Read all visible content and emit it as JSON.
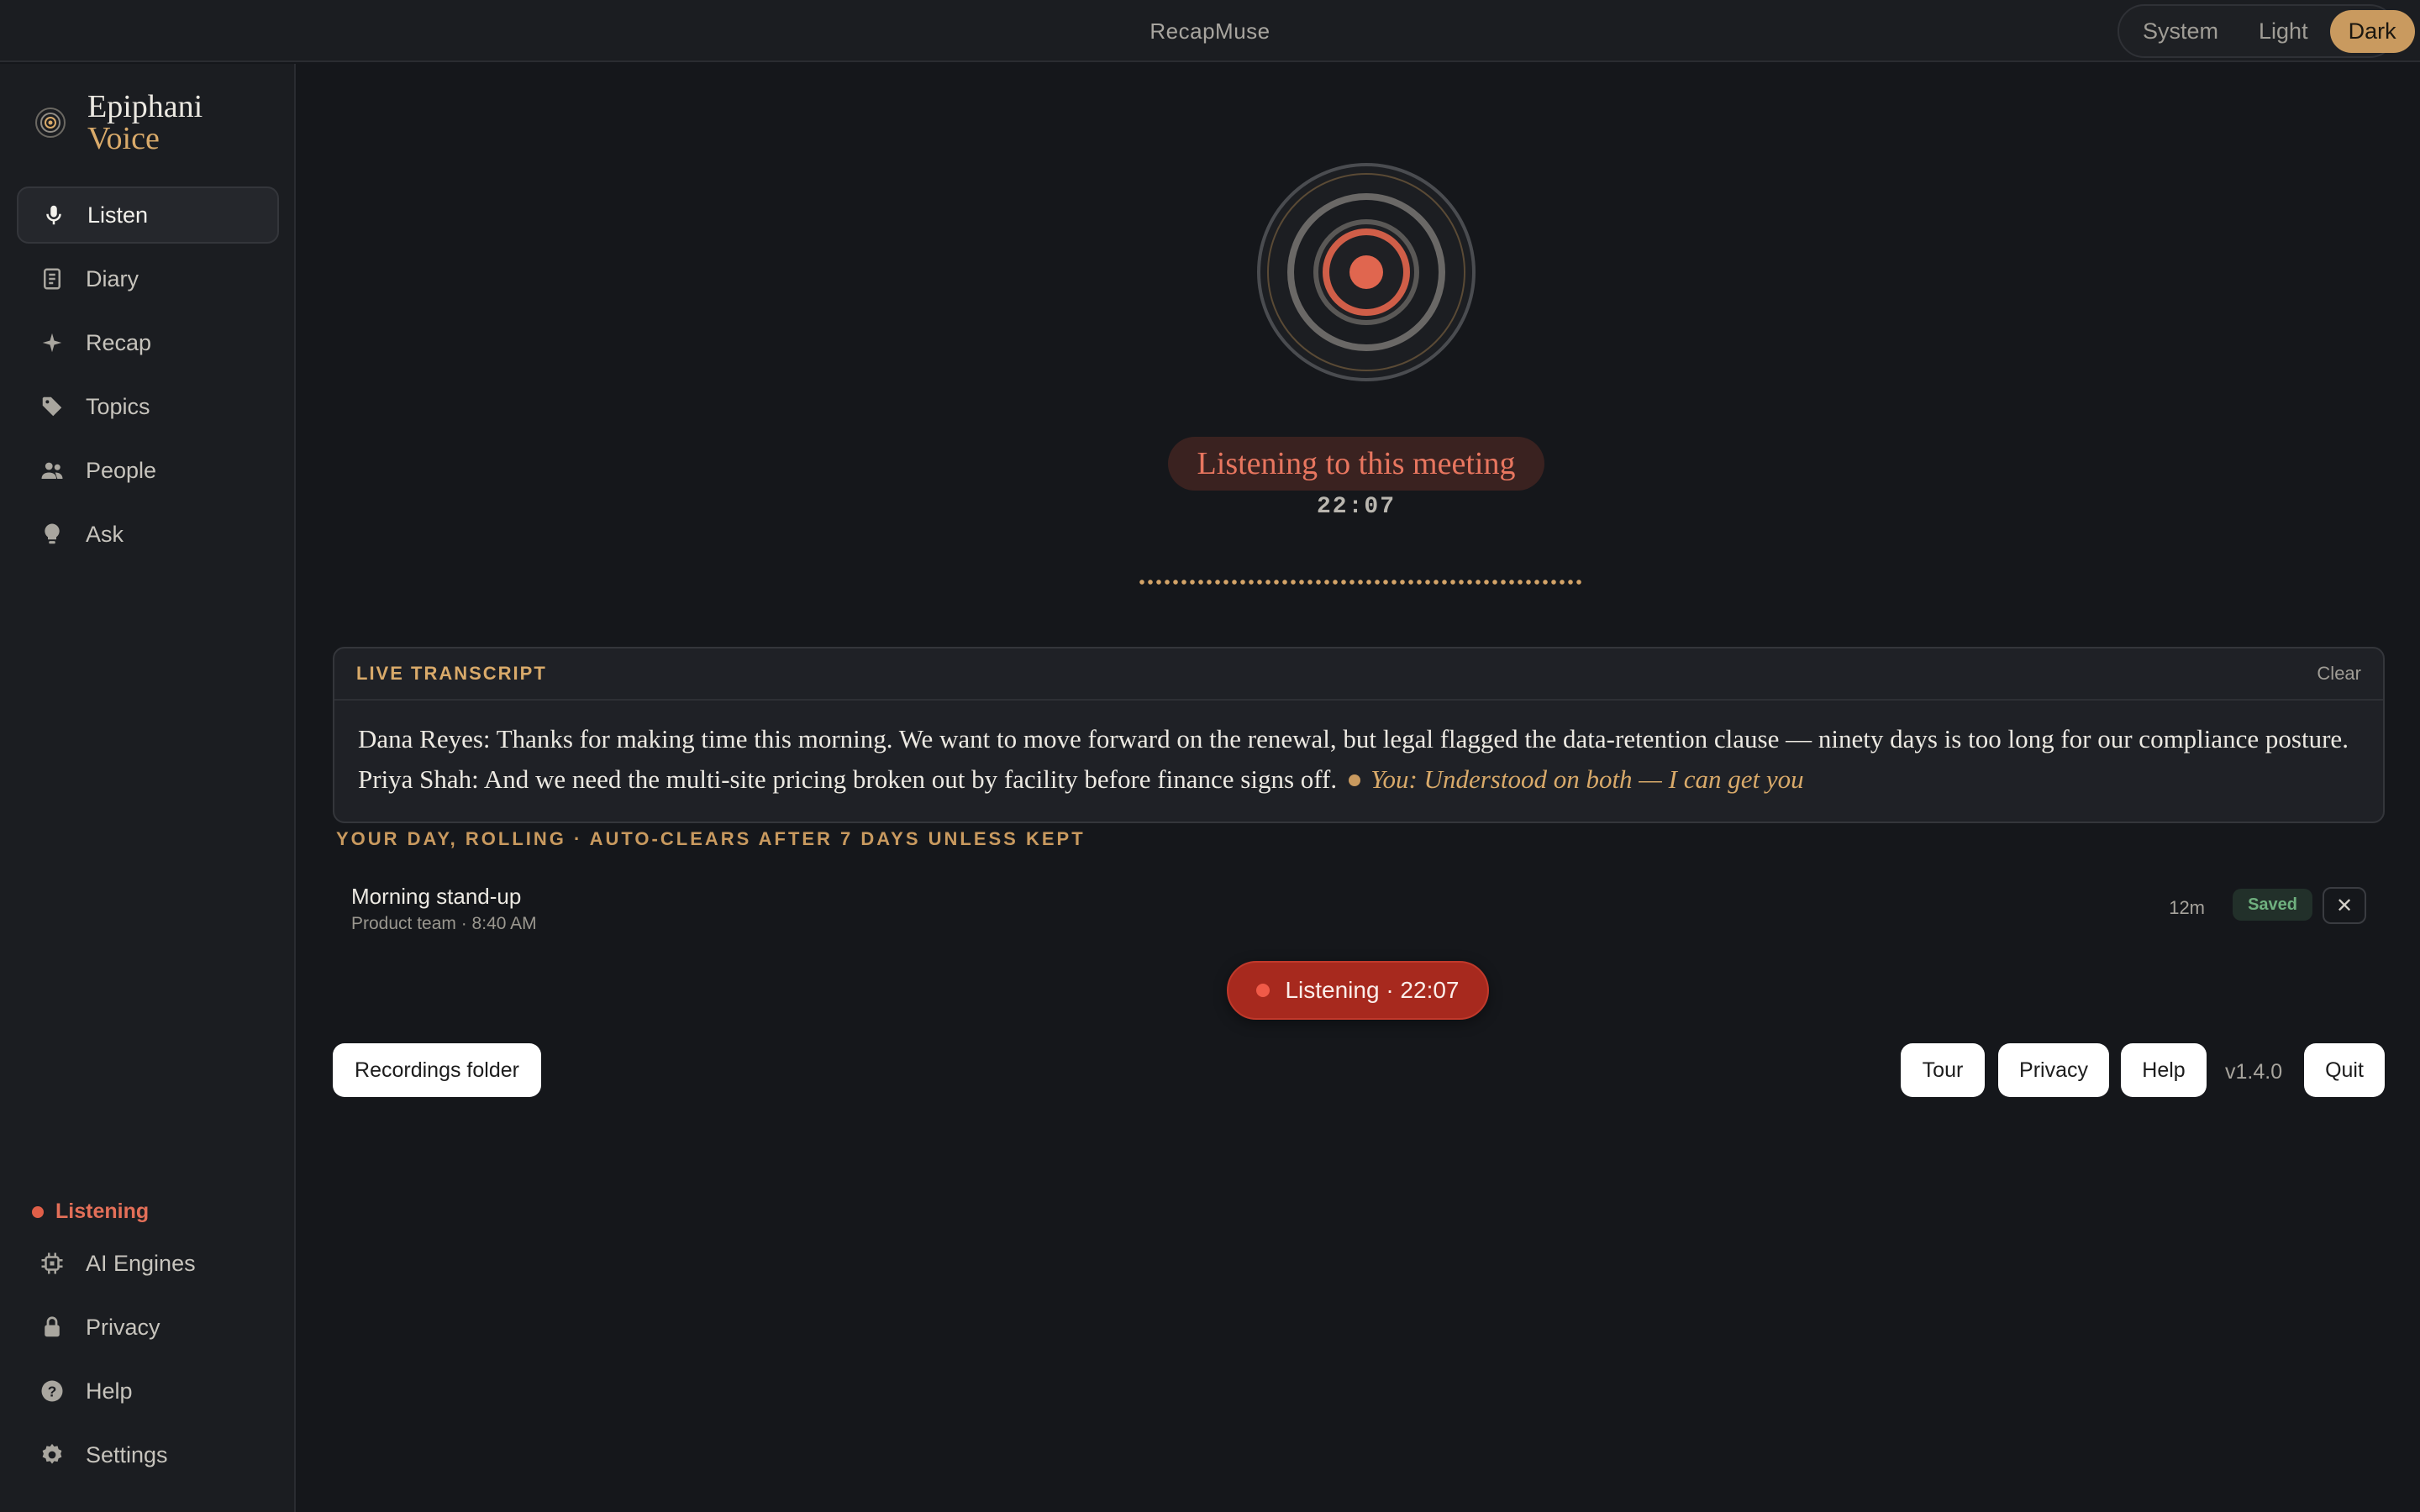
{
  "app": {
    "title": "RecapMuse"
  },
  "theme": {
    "options": [
      "System",
      "Light",
      "Dark"
    ],
    "selected": "Dark"
  },
  "brand": {
    "line1": "Epiphani",
    "line2": "Voice"
  },
  "sidebar": {
    "items": [
      {
        "label": "Listen",
        "icon": "microphone-icon",
        "active": true
      },
      {
        "label": "Diary",
        "icon": "journal-icon"
      },
      {
        "label": "Recap",
        "icon": "sparkle-icon"
      },
      {
        "label": "Topics",
        "icon": "tag-icon"
      },
      {
        "label": "People",
        "icon": "people-icon"
      },
      {
        "label": "Ask",
        "icon": "lightbulb-icon"
      }
    ],
    "status": "Listening",
    "bottom_items": [
      {
        "label": "AI Engines",
        "icon": "chip-icon"
      },
      {
        "label": "Privacy",
        "icon": "lock-icon"
      },
      {
        "label": "Help",
        "icon": "question-icon"
      },
      {
        "label": "Settings",
        "icon": "gear-icon"
      }
    ]
  },
  "main": {
    "status_text": "Listening to this meeting",
    "timer": "22:07",
    "transcript": {
      "title": "LIVE TRANSCRIPT",
      "clear_label": "Clear",
      "line1": "Dana Reyes: Thanks for making time this morning. We want to move forward on the renewal, but legal flagged the data-retention clause — ninety days is too long for our compliance posture.",
      "line2": "Priya Shah: And we need the multi-site pricing broken out by facility before finance signs off.",
      "live": "You: Understood on both — I can get you"
    },
    "day": {
      "label": "YOUR DAY, ROLLING · AUTO-CLEARS AFTER 7 DAYS UNLESS KEPT",
      "items": [
        {
          "title": "Morning stand-up",
          "subtitle": "Product team · 8:40 AM",
          "duration": "12m",
          "badge": "Saved",
          "remove": "✕"
        }
      ]
    },
    "listen_button": "Listening · 22:07",
    "footer": {
      "recordings": "Recordings folder",
      "tour": "Tour",
      "privacy": "Privacy",
      "help": "Help",
      "version": "v1.4.0",
      "quit": "Quit"
    }
  },
  "colors": {
    "accent": "#c99a5f",
    "recording": "#a7291e",
    "background": "#15171b"
  }
}
